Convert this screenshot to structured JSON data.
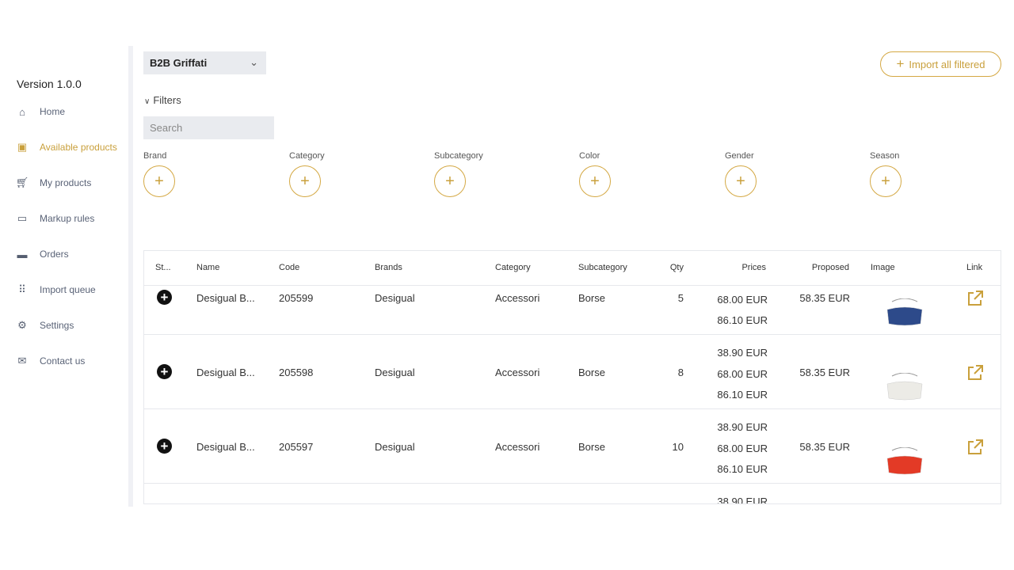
{
  "sidebar": {
    "version": "Version 1.0.0",
    "items": [
      {
        "label": "Home",
        "icon": "home-icon"
      },
      {
        "label": "Available products",
        "icon": "box-icon",
        "active": true
      },
      {
        "label": "My products",
        "icon": "cart-icon"
      },
      {
        "label": "Markup rules",
        "icon": "money-icon"
      },
      {
        "label": "Orders",
        "icon": "truck-icon"
      },
      {
        "label": "Import queue",
        "icon": "grid-icon"
      },
      {
        "label": "Settings",
        "icon": "gears-icon"
      },
      {
        "label": "Contact us",
        "icon": "envelope-icon"
      }
    ]
  },
  "store_select": {
    "value": "B2B Griffati"
  },
  "import_all": {
    "label": "Import all filtered"
  },
  "filters": {
    "label": "Filters",
    "search_placeholder": "Search",
    "fields": [
      "Brand",
      "Category",
      "Subcategory",
      "Color",
      "Gender",
      "Season"
    ]
  },
  "table": {
    "headers": [
      "St...",
      "Name",
      "Code",
      "Brands",
      "Category",
      "Subcategory",
      "Qty",
      "Prices",
      "Proposed",
      "Image",
      "Link"
    ],
    "rows": [
      {
        "name": "Desigual B...",
        "code": "205599",
        "brand": "Desigual",
        "category": "Accessori",
        "subcategory": "Borse",
        "qty": "5",
        "prices": [
          "68.00 EUR",
          "86.10 EUR"
        ],
        "proposed": "58.35 EUR",
        "image_color": "#2d4a8a"
      },
      {
        "name": "Desigual B...",
        "code": "205598",
        "brand": "Desigual",
        "category": "Accessori",
        "subcategory": "Borse",
        "qty": "8",
        "prices": [
          "38.90 EUR",
          "68.00 EUR",
          "86.10 EUR"
        ],
        "proposed": "58.35 EUR",
        "image_color": "#ecebe6"
      },
      {
        "name": "Desigual B...",
        "code": "205597",
        "brand": "Desigual",
        "category": "Accessori",
        "subcategory": "Borse",
        "qty": "10",
        "prices": [
          "38.90 EUR",
          "68.00 EUR",
          "86.10 EUR"
        ],
        "proposed": "58.35 EUR",
        "image_color": "#e33a26"
      },
      {
        "prices": [
          "38.90 EUR"
        ]
      }
    ]
  },
  "colors": {
    "accent": "#c9a03c"
  }
}
